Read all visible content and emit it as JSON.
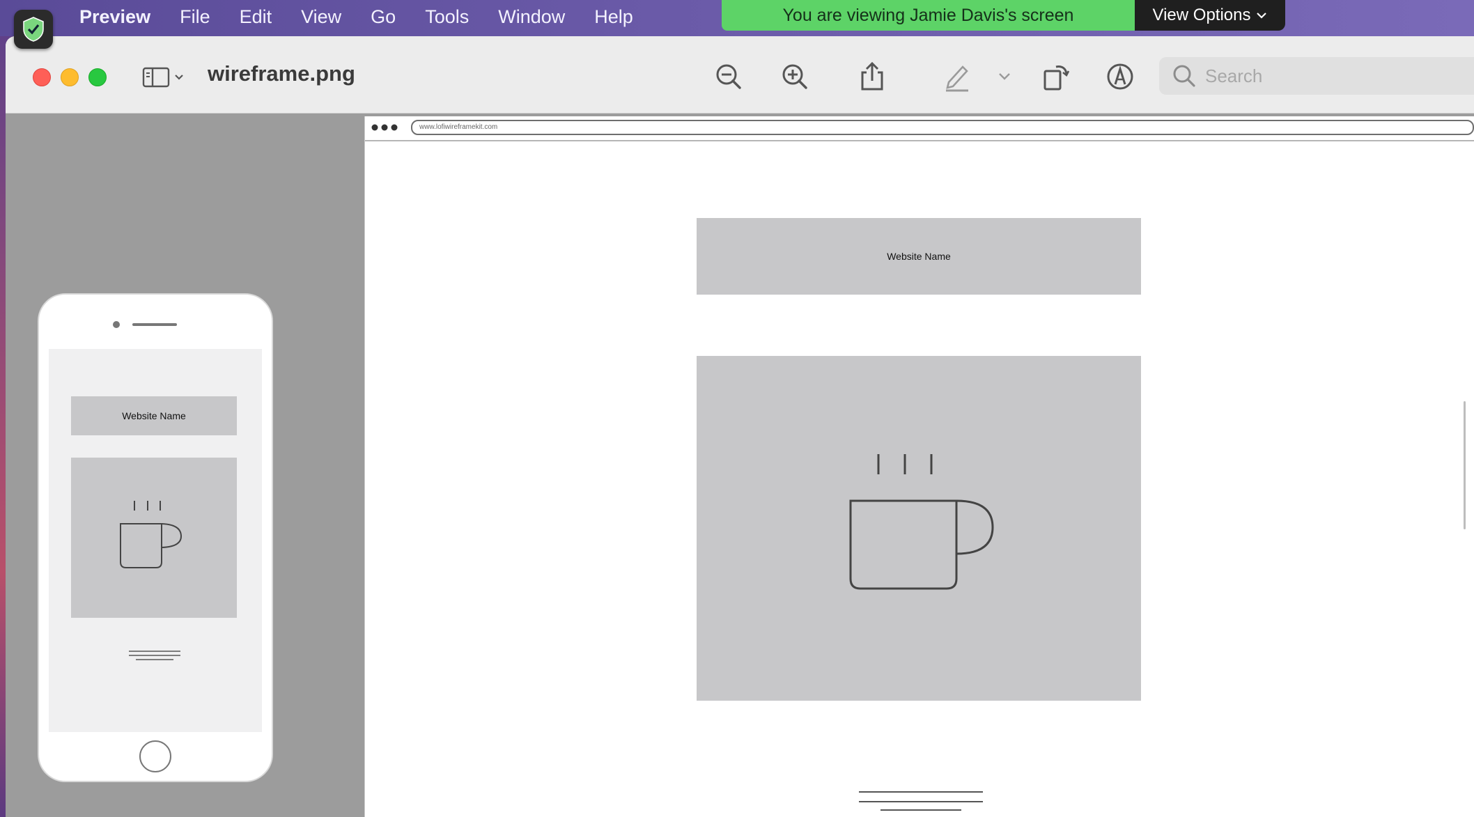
{
  "menubar": {
    "app_name": "Preview",
    "items": [
      "File",
      "Edit",
      "View",
      "Go",
      "Tools",
      "Window",
      "Help"
    ]
  },
  "screen_share": {
    "banner_text": "You are viewing Jamie Davis's screen",
    "view_options_label": "View Options",
    "banner_color": "#5dd367"
  },
  "window": {
    "title": "wireframe.png",
    "search_placeholder": "Search",
    "toolbar_icons": [
      "sidebar-toggle-icon",
      "zoom-out-icon",
      "zoom-in-icon",
      "share-icon",
      "highlight-pen-icon",
      "rotate-icon",
      "markup-icon",
      "search-icon"
    ]
  },
  "thumbnail": {
    "header_text": "Website Name"
  },
  "document": {
    "url_text": "www.lofiwireframekit.com",
    "header_text": "Website Name"
  },
  "colors": {
    "close": "#fe5f57",
    "minimize": "#febc2e",
    "maximize": "#28c840",
    "wireframe_block": "#c7c7c9"
  }
}
